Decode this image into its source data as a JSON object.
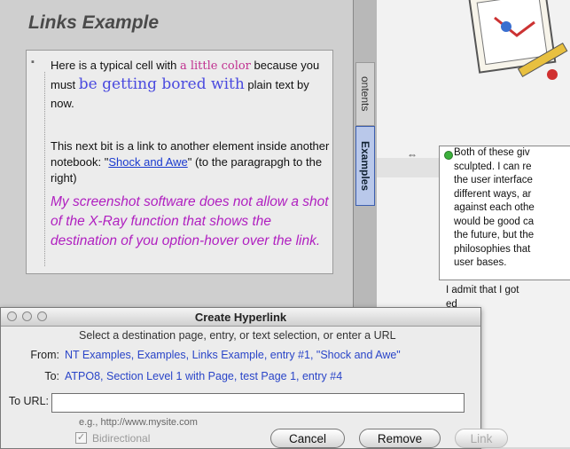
{
  "left": {
    "title": "Links Example",
    "p1_a": "Here is a typical cell with ",
    "p1_color": "a little color",
    "p1_b": " because you must ",
    "p1_big": "be getting bored with",
    "p1_c": " plain text by now.",
    "p2_a": "This next bit is a link to another element inside another notebook: \"",
    "p2_link": "Shock and Awe",
    "p2_b": "\" (to the paragrapgh to the right)",
    "p3": "My screenshot software does not allow a shot of the X-Ray function that shows the destination of you option-hover over the link."
  },
  "tabs": [
    "ontents",
    "Examples"
  ],
  "right": {
    "entry": "Both of these giv\nsculpted. I can re\nthe user interface\ndifferent ways, ar\nagainst each othe\nwould be good ca\nthe future, but the\nphilosophies that\nuser bases.",
    "more": "I admit that I got\ned\nan\nvi\nh\nw\nr in"
  },
  "dialog": {
    "title": "Create Hyperlink",
    "instructions": "Select a destination page, entry, or text selection, or enter a URL",
    "from_label": "From:",
    "from_value": "NT Examples, Examples, Links Example, entry #1, \"Shock and Awe\"",
    "to_label": "To:",
    "to_value": "ATPO8, Section Level 1 with Page, test Page 1, entry #4",
    "url_label": "To URL:",
    "url_value": "",
    "url_hint": "e.g., http://www.mysite.com",
    "bidirectional_label": "Bidirectional",
    "bidirectional_checked": true,
    "cancel_label": "Cancel",
    "remove_label": "Remove",
    "link_label": "Link"
  },
  "colors": {
    "link": "#1a3acf",
    "accent_pink": "#c03090",
    "accent_blue": "#4a4adf",
    "italic_magenta": "#b020c0"
  }
}
